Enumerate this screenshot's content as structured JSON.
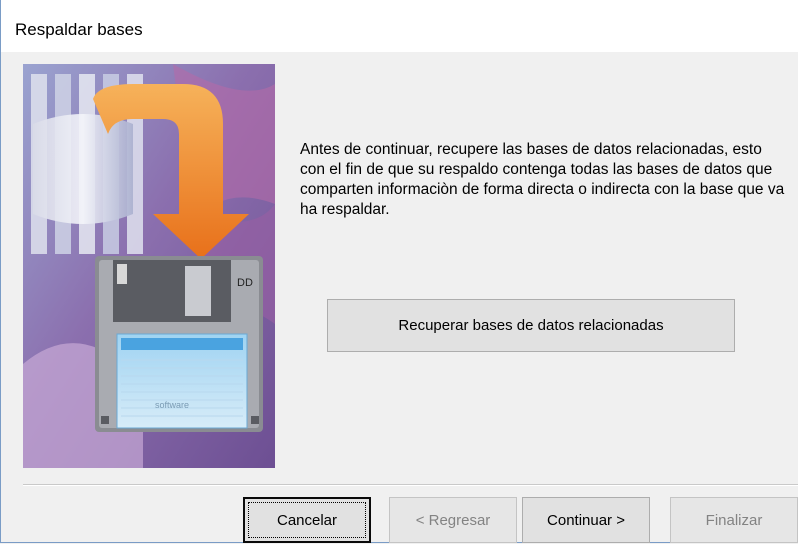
{
  "window": {
    "title": "Respaldar bases"
  },
  "illustration": {
    "brand_text": "software"
  },
  "content": {
    "message": "Antes de continuar, recupere las bases de datos relacionadas, esto con el fin de que su respaldo contenga todas las bases de datos que comparten informaciòn de forma directa o indirecta con la base que va ha respaldar."
  },
  "buttons": {
    "recover_label": "Recuperar bases de datos relacionadas",
    "cancel_label": "Cancelar",
    "back_label": "< Regresar",
    "next_label": "Continuar >",
    "finish_label": "Finalizar"
  },
  "colors": {
    "window_border": "#7a9cc6",
    "button_face": "#e1e1e1",
    "disabled_text": "#838383",
    "arrow": "#f08a24"
  }
}
